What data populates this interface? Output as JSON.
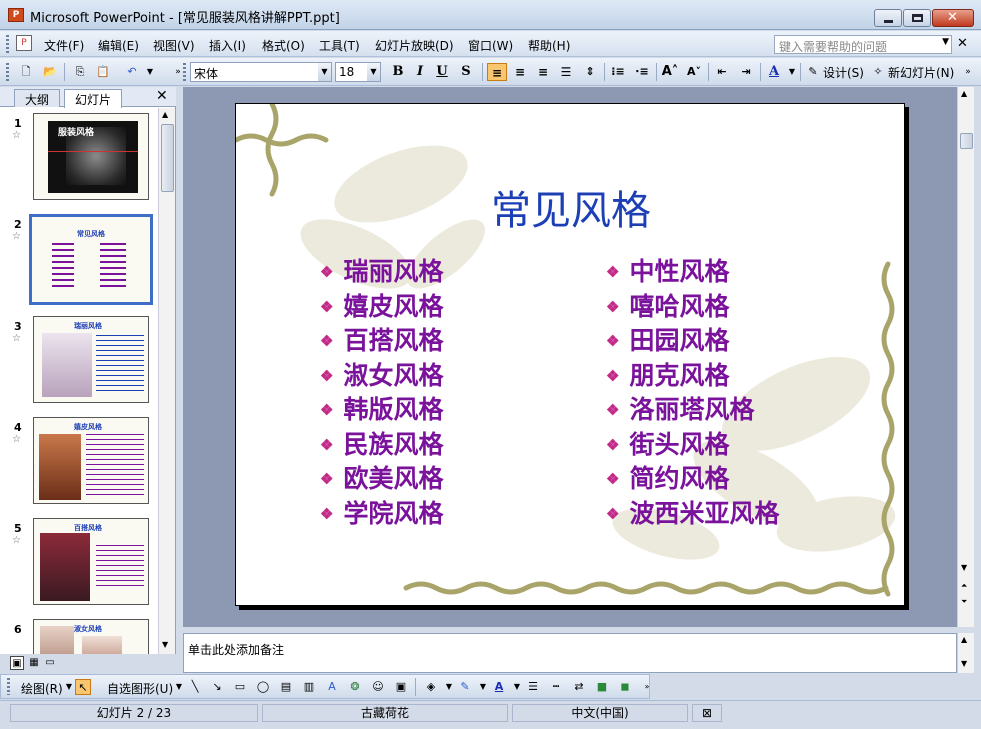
{
  "window": {
    "title": "Microsoft PowerPoint - [常见服装风格讲解PPT.ppt]"
  },
  "menu": {
    "items": [
      "文件(F)",
      "编辑(E)",
      "视图(V)",
      "插入(I)",
      "格式(O)",
      "工具(T)",
      "幻灯片放映(D)",
      "窗口(W)",
      "帮助(H)"
    ],
    "help_placeholder": "键入需要帮助的问题"
  },
  "toolbar": {
    "font_name": "宋体",
    "font_size": "18",
    "design_label": "设计(S)",
    "new_slide_label": "新幻灯片(N)"
  },
  "panel": {
    "tabs": [
      "大纲",
      "幻灯片"
    ],
    "thumbnails": [
      {
        "number": "1",
        "title": "服装风格"
      },
      {
        "number": "2",
        "title": "常见风格"
      },
      {
        "number": "3",
        "title": "瑞丽风格"
      },
      {
        "number": "4",
        "title": "嬉皮风格"
      },
      {
        "number": "5",
        "title": "百搭风格"
      },
      {
        "number": "6",
        "title": "淑女风格"
      }
    ],
    "selected_index": 1
  },
  "slide": {
    "title": "常见风格",
    "left_items": [
      "瑞丽风格",
      "嬉皮风格",
      "百搭风格",
      "淑女风格",
      "韩版风格",
      "民族风格",
      "欧美风格",
      "学院风格"
    ],
    "right_items": [
      "中性风格",
      "嘻哈风格",
      "田园风格",
      "朋克风格",
      "洛丽塔风格",
      "街头风格",
      "简约风格",
      "波西米亚风格"
    ]
  },
  "notes": {
    "placeholder": "单击此处添加备注"
  },
  "drawbar": {
    "draw_label": "绘图(R)",
    "autoshape_label": "自选图形(U)"
  },
  "status": {
    "slide_info": "幻灯片 2 / 23",
    "design_name": "古藏荷花",
    "language": "中文(中国)"
  },
  "colors": {
    "slide_title": "#1c3fb6",
    "slide_text": "#7a129c",
    "bullet": "#c22a88",
    "slide_area_bg": "#8d99b3"
  }
}
